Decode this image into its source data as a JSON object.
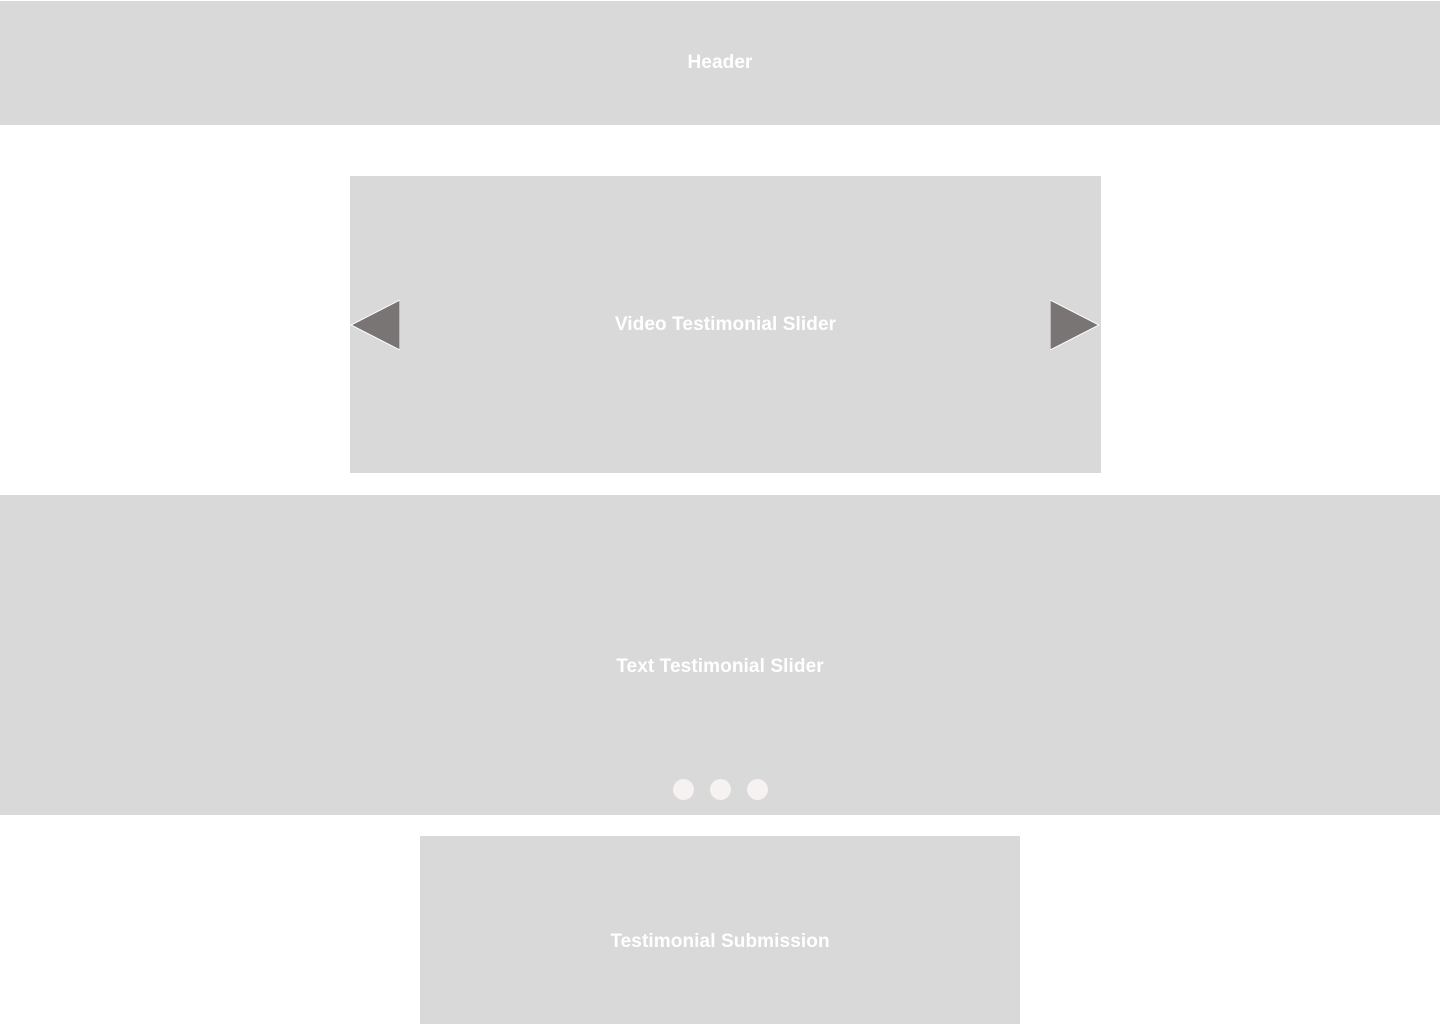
{
  "header": {
    "label": "Header"
  },
  "video_slider": {
    "label": "Video Testimonial Slider",
    "prev_icon": "triangle-left-icon",
    "next_icon": "triangle-right-icon"
  },
  "text_slider": {
    "label": "Text Testimonial Slider",
    "dots": [
      "dot-1",
      "dot-2",
      "dot-3"
    ]
  },
  "submission": {
    "label": "Testimonial Submission"
  },
  "colors": {
    "placeholder": "#d9d9d9",
    "text": "#ffffff",
    "arrow": "#7a7575",
    "dot": "#f5f2f1",
    "background": "#ffffff"
  }
}
